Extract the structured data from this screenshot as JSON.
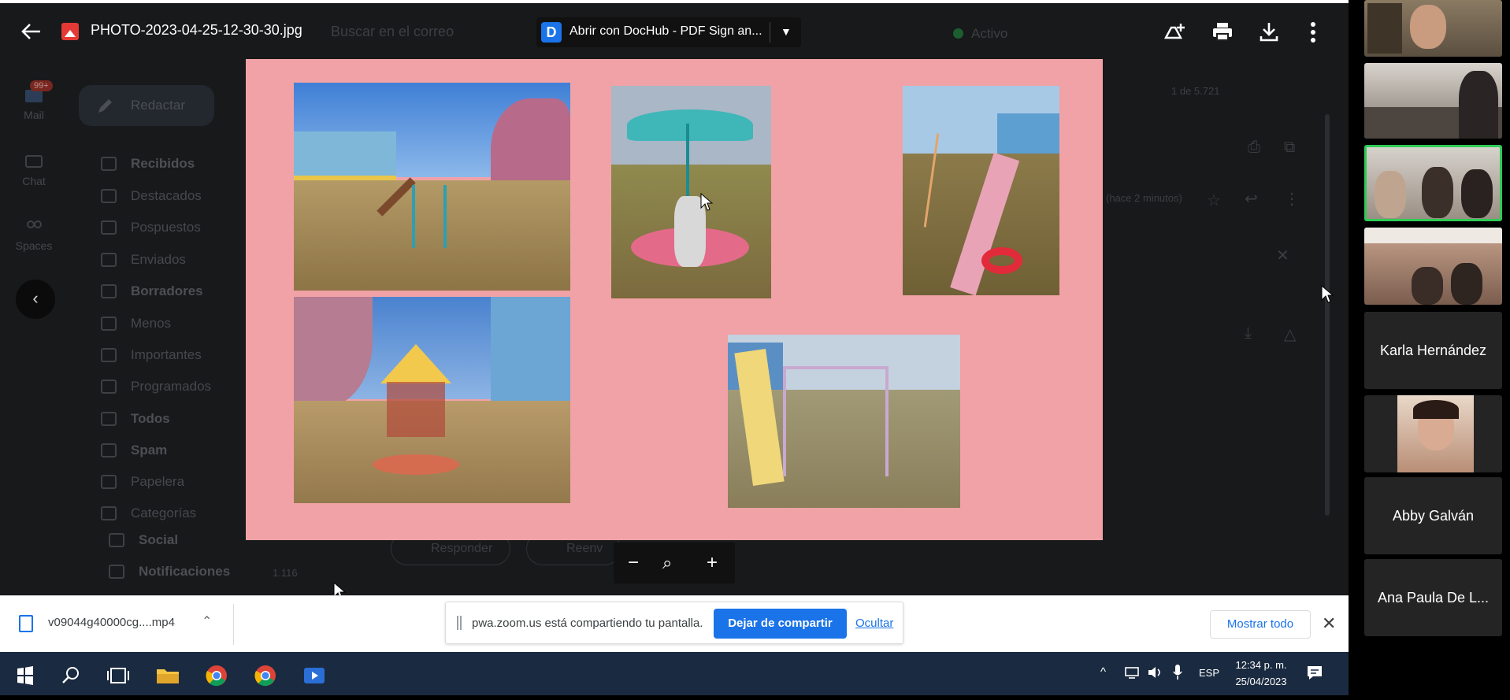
{
  "viewer": {
    "filename": "PHOTO-2023-04-25-12-30-30.jpg",
    "open_with": "Abrir con DocHub - PDF Sign an...",
    "icons": [
      "back-arrow-icon",
      "add-to-drive-icon",
      "print-icon",
      "download-icon",
      "more-vert-icon"
    ]
  },
  "gmail": {
    "rail": [
      {
        "label": "Mail",
        "badge": "99+"
      },
      {
        "label": "Chat"
      },
      {
        "label": "Spaces"
      }
    ],
    "compose_label": "Redactar",
    "search_placeholder": "Buscar en el correo",
    "status": "Activo",
    "pager": "1 de 5.721",
    "time_ago": "(hace 2 minutos)",
    "folders": [
      {
        "label": "Recibidos",
        "bold": true
      },
      {
        "label": "Destacados",
        "bold": false
      },
      {
        "label": "Pospuestos",
        "bold": false
      },
      {
        "label": "Enviados",
        "bold": false
      },
      {
        "label": "Borradores",
        "bold": true
      },
      {
        "label": "Menos",
        "bold": false
      },
      {
        "label": "Importantes",
        "bold": false
      },
      {
        "label": "Programados",
        "bold": false
      },
      {
        "label": "Todos",
        "bold": true
      },
      {
        "label": "Spam",
        "bold": true
      },
      {
        "label": "Papelera",
        "bold": false
      },
      {
        "label": "Categorías",
        "bold": false
      },
      {
        "label": "Social",
        "bold": true
      },
      {
        "label": "Notificaciones",
        "bold": true
      }
    ],
    "notifications_count": "1.116",
    "reply": "Responder",
    "forward": "Reenv"
  },
  "downloads": {
    "file": "v09044g40000cg....mp4",
    "share_message": "pwa.zoom.us está compartiendo tu pantalla.",
    "stop_sharing": "Dejar de compartir",
    "hide": "Ocultar",
    "show_all": "Mostrar todo"
  },
  "taskbar": {
    "language": "ESP",
    "time": "12:34 p. m.",
    "date": "25/04/2023"
  },
  "participants": [
    {
      "type": "video",
      "speaking": false
    },
    {
      "type": "video",
      "speaking": false
    },
    {
      "type": "video",
      "speaking": true
    },
    {
      "type": "video",
      "speaking": false
    },
    {
      "type": "name",
      "name": "Karla Hernández"
    },
    {
      "type": "video",
      "speaking": false
    },
    {
      "type": "name",
      "name": "Abby Galván"
    },
    {
      "type": "name",
      "name": "Ana Paula De L..."
    }
  ],
  "colors": {
    "slide_background": "#f1a2a6",
    "share_button": "#1a73e8",
    "active_speaker_border": "#2ecc55",
    "taskbar": "#1a2a40"
  }
}
